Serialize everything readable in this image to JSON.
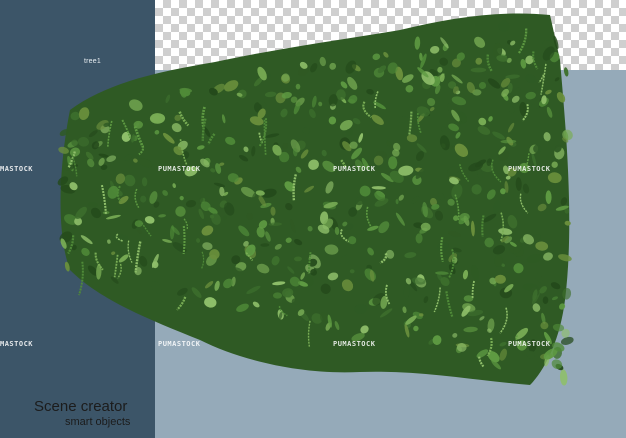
{
  "scene": {
    "layer_label": "tree1",
    "watermark_text": "PUMASTOCK",
    "watermark_partial": "MASTOCK",
    "brand_title": "Scene creator",
    "brand_subtitle": "smart objects"
  },
  "colors": {
    "left_panel": "#3c5568",
    "canvas_background": "#95aab9",
    "foliage_dark": "#2f5a24",
    "foliage_mid": "#4f8a38",
    "foliage_light": "#8fbf6a"
  }
}
